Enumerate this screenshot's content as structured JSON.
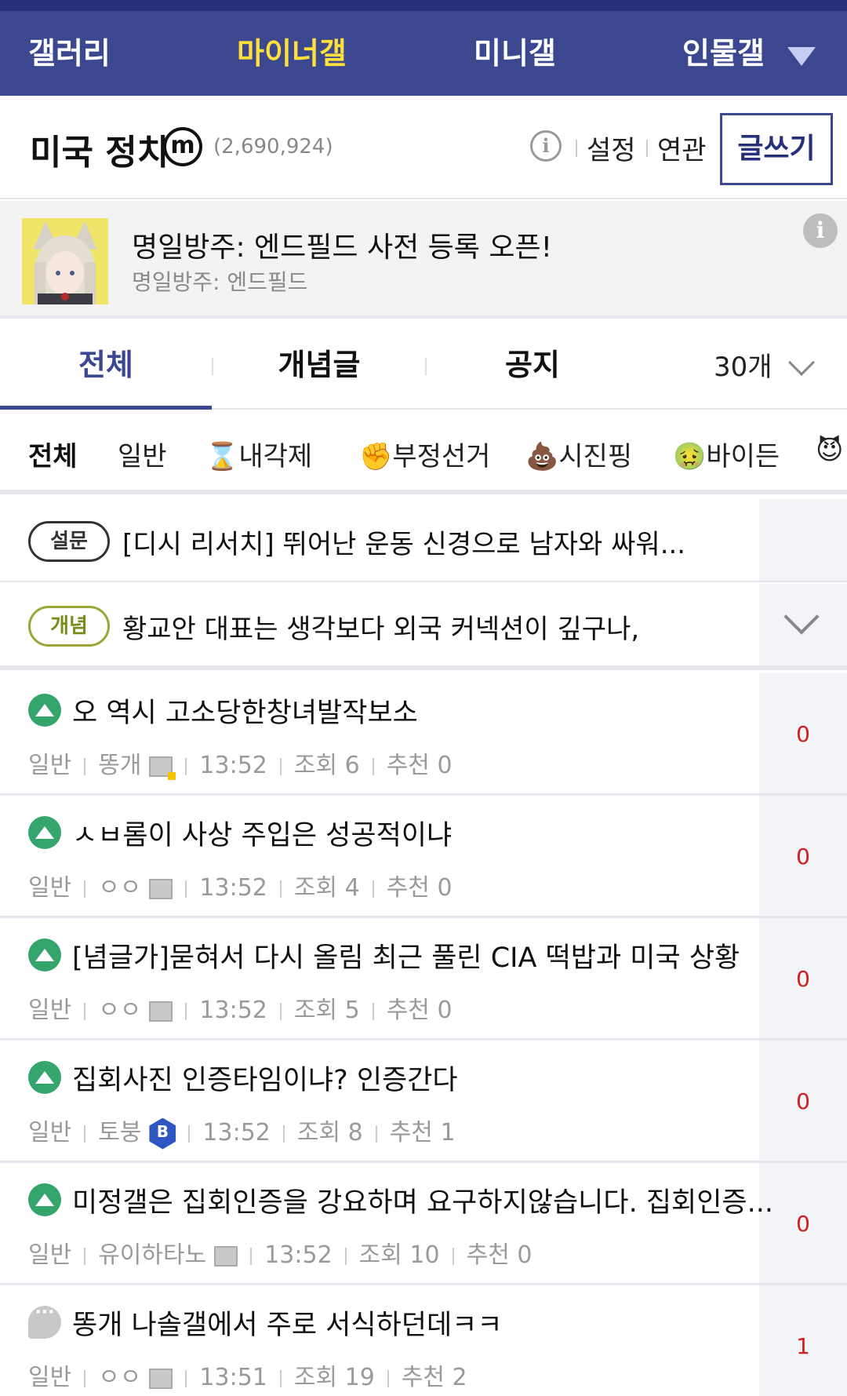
{
  "top_nav": {
    "items": [
      "갤러리",
      "마이너갤",
      "미니갤",
      "인물갤"
    ],
    "active": "마이너갤"
  },
  "gallery": {
    "title": "미국 정치",
    "badge": "m",
    "count": "(2,690,924)",
    "links": [
      "설정",
      "연관"
    ],
    "write_label": "글쓰기"
  },
  "ad": {
    "title": "명일방주: 엔드필드 사전 등록 오픈!",
    "subtitle": "명일방주: 엔드필드",
    "info": "i"
  },
  "tabs": {
    "items": [
      "전체",
      "개념글",
      "공지"
    ],
    "active": "전체",
    "per_page": "30개"
  },
  "categories": [
    {
      "label": "전체",
      "icon": ""
    },
    {
      "label": "일반",
      "icon": ""
    },
    {
      "label": "내각제",
      "icon": "⌛"
    },
    {
      "label": "부정선거",
      "icon": "✊"
    },
    {
      "label": "시진핑",
      "icon": "💩"
    },
    {
      "label": "바이든",
      "icon": "🤢"
    },
    {
      "label": "",
      "icon": "😈"
    }
  ],
  "notices": [
    {
      "tag": "설문",
      "text": "[디시 리서치] 뛰어난 운동 신경으로 남자와 싸워..."
    },
    {
      "tag": "개념",
      "text": "황교안 대표는 생각보다 외국 커넥션이 깊구나,"
    }
  ],
  "posts": [
    {
      "icon": "image-post-icon",
      "title": "오 역시 고소당한창녀발작보소",
      "category": "일반",
      "author": "똥개",
      "time": "13:52",
      "views": "조회 6",
      "recommend": "추천 0",
      "comments": "0"
    },
    {
      "icon": "image-post-icon",
      "title": "ㅅㅂ롬이 사상 주입은 성공적이냐",
      "category": "일반",
      "author": "ㅇㅇ",
      "time": "13:52",
      "views": "조회 4",
      "recommend": "추천 0",
      "comments": "0"
    },
    {
      "icon": "image-post-icon",
      "title": "[념글가]묻혀서 다시 올림 최근 풀린 CIA 떡밥과 미국 상황",
      "category": "일반",
      "author": "ㅇㅇ",
      "time": "13:52",
      "views": "조회 5",
      "recommend": "추천 0",
      "comments": "0"
    },
    {
      "icon": "image-post-icon",
      "title": "집회사진 인증타임이냐? 인증간다",
      "category": "일반",
      "author": "토붕",
      "time": "13:52",
      "views": "조회 8",
      "recommend": "추천 1",
      "comments": "0"
    },
    {
      "icon": "image-post-icon",
      "title": "미정갤은 집회인증을 강요하며 요구하지않습니다. 집회인증...",
      "category": "일반",
      "author": "유이하타노",
      "time": "13:52",
      "views": "조회 10",
      "recommend": "추천 0",
      "comments": "0"
    },
    {
      "icon": "text-post-icon",
      "title": "똥개 나솔갤에서 주로 서식하던데ㅋㅋ",
      "category": "일반",
      "author": "ㅇㅇ",
      "time": "13:51",
      "views": "조회 19",
      "recommend": "추천 2",
      "comments": "1"
    }
  ]
}
